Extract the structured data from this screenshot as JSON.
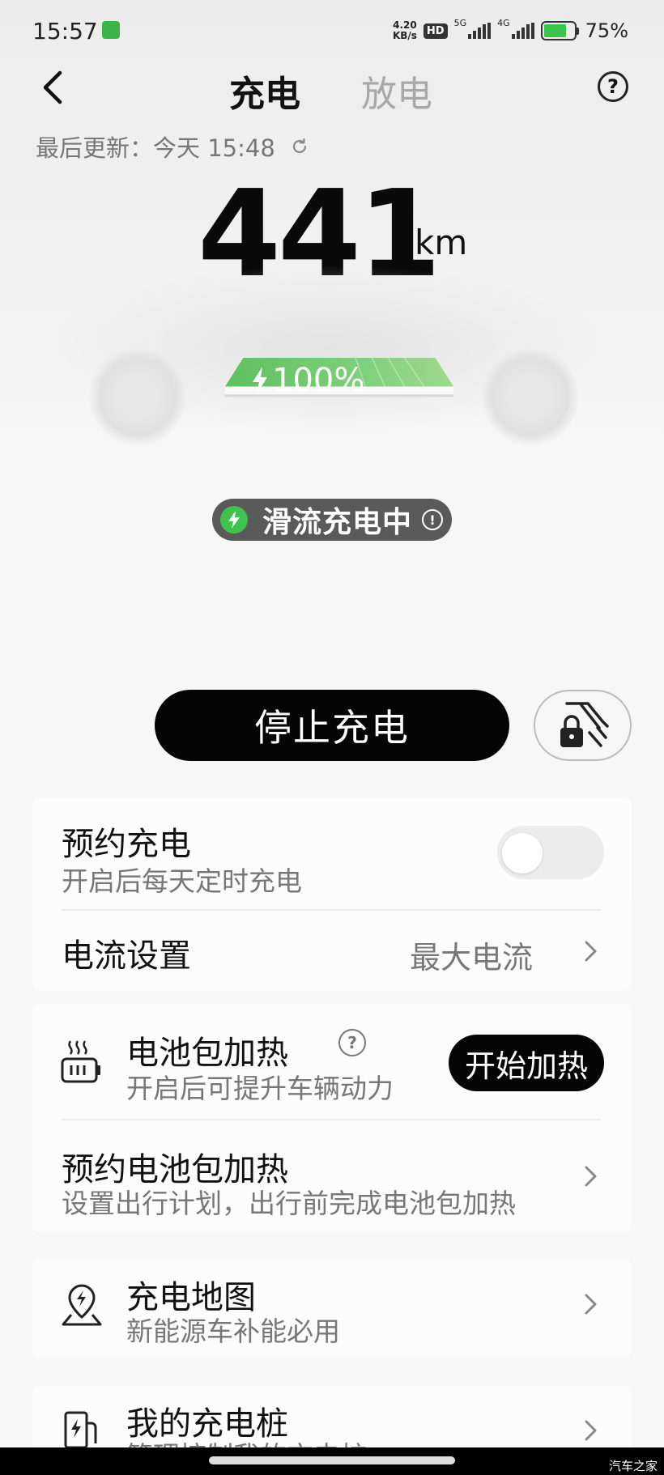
{
  "status_bar": {
    "time": "15:57",
    "net_speed_value": "4.20",
    "net_speed_unit": "KB/s",
    "hd_badge": "HD",
    "signal1_label": "5G",
    "signal2_label": "4G",
    "battery_percent": "75%",
    "battery_level": 0.75
  },
  "header": {
    "tab_charge": "充电",
    "tab_discharge": "放电",
    "help_icon_glyph": "?"
  },
  "last_update": "最后更新：今天 15:48",
  "range": {
    "value": "441",
    "unit": "km"
  },
  "battery": {
    "percent": "100%",
    "level": 1.0,
    "color": "#5cbf5c"
  },
  "charging_status": {
    "label": "滑流充电中",
    "info_glyph": "!"
  },
  "actions": {
    "stop_charging": "停止充电"
  },
  "settings_card": {
    "scheduled_charging_title": "预约充电",
    "scheduled_charging_sub": "开启后每天定时充电",
    "scheduled_charging_enabled": false,
    "current_setting_title": "电流设置",
    "current_setting_value": "最大电流"
  },
  "heating_card": {
    "battery_heating_title": "电池包加热",
    "battery_heating_sub": "开启后可提升车辆动力",
    "help_glyph": "?",
    "start_heating": "开始加热",
    "scheduled_heating_title": "预约电池包加热",
    "scheduled_heating_sub": "设置出行计划，出行前完成电池包加热"
  },
  "charge_map": {
    "title": "充电地图",
    "sub": "新能源车补能必用"
  },
  "my_charger": {
    "title": "我的充电桩",
    "sub": "管理控制我的充电桩"
  },
  "watermark": "汽车之家",
  "colors": {
    "accent_green": "#3cc44c",
    "button_black": "#050505"
  }
}
